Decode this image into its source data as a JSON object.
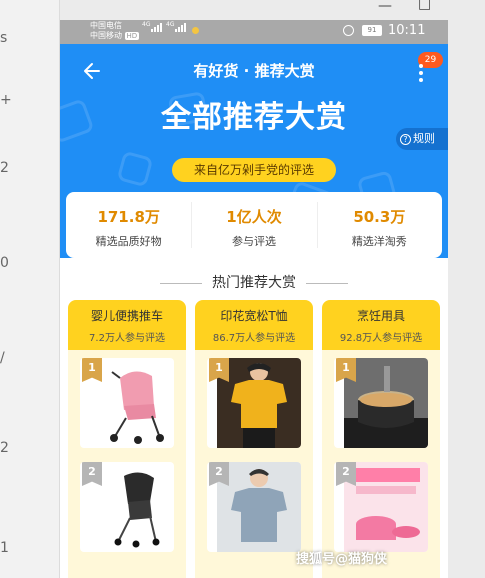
{
  "statusbar": {
    "carrier1": "中国电信",
    "carrier2": "中国移动",
    "hd": "HD",
    "net1": "4G",
    "net2": "4G",
    "battery": "91",
    "time": "10:11"
  },
  "header": {
    "app_title": "有好货 · 推荐大赏",
    "main_title": "全部推荐大赏",
    "subtitle": "来自亿万剁手党的评选",
    "rules_label": "规则",
    "badge": "29"
  },
  "stats": [
    {
      "value": "171.8万",
      "label": "精选品质好物"
    },
    {
      "value": "1亿人次",
      "label": "参与评选"
    },
    {
      "value": "50.3万",
      "label": "精选洋淘秀"
    }
  ],
  "section": {
    "title": "热门推荐大赏",
    "columns": [
      {
        "name": "婴儿便携推车",
        "count": "7.2万人参与评选",
        "items": [
          {
            "rank": "1"
          },
          {
            "rank": "2"
          }
        ]
      },
      {
        "name": "印花宽松T恤",
        "count": "86.7万人参与评选",
        "items": [
          {
            "rank": "1"
          },
          {
            "rank": "2"
          }
        ]
      },
      {
        "name": "烹饪用具",
        "count": "92.8万人参与评选",
        "items": [
          {
            "rank": "1"
          },
          {
            "rank": "2"
          }
        ]
      }
    ]
  },
  "watermark": "搜狐号@猫狗侠",
  "colors": {
    "header_blue": "#1f8ef5",
    "accent_yellow": "#ffd21f",
    "stat_orange": "#e08a00",
    "badge_red": "#ff5a1f"
  }
}
